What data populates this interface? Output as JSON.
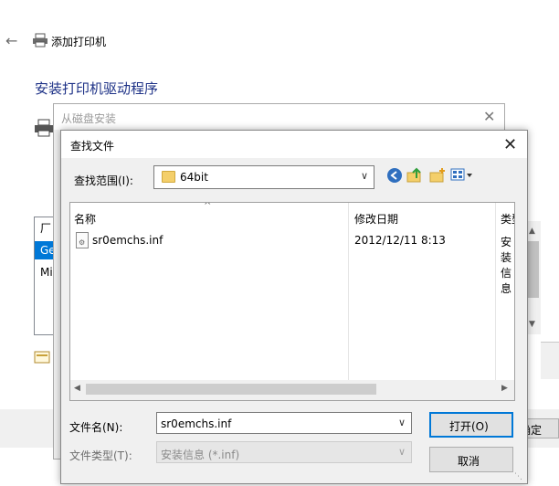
{
  "wizard": {
    "title": "添加打印机",
    "heading": "安装打印机驱动程序",
    "manufacturers": [
      "厂",
      "Ge",
      "Mi"
    ],
    "bottom_button": "确定"
  },
  "disk_dialog": {
    "title": "从磁盘安装"
  },
  "open_dialog": {
    "title": "查找文件",
    "look_in_label": "查找范围(I):",
    "look_in_value": "64bit",
    "columns": {
      "name": "名称",
      "date": "修改日期",
      "type": "类型"
    },
    "files": [
      {
        "name": "sr0emchs.inf",
        "date": "2012/12/11 8:13",
        "type": "安装信息"
      }
    ],
    "file_name_label": "文件名(N):",
    "file_name_value": "sr0emchs.inf",
    "file_type_label": "文件类型(T):",
    "file_type_value": "安装信息 (*.inf)",
    "open_button": "打开(O)",
    "cancel_button": "取消"
  },
  "colors": {
    "accent": "#0078d7",
    "heading": "#1e3287",
    "folder": "#f4cf6a"
  },
  "icons": [
    "back-arrow-icon",
    "printer-icon",
    "close-icon",
    "folder-icon",
    "back-icon",
    "up-folder-icon",
    "new-folder-icon",
    "view-menu-icon",
    "inf-file-icon",
    "chevron-down-icon"
  ]
}
